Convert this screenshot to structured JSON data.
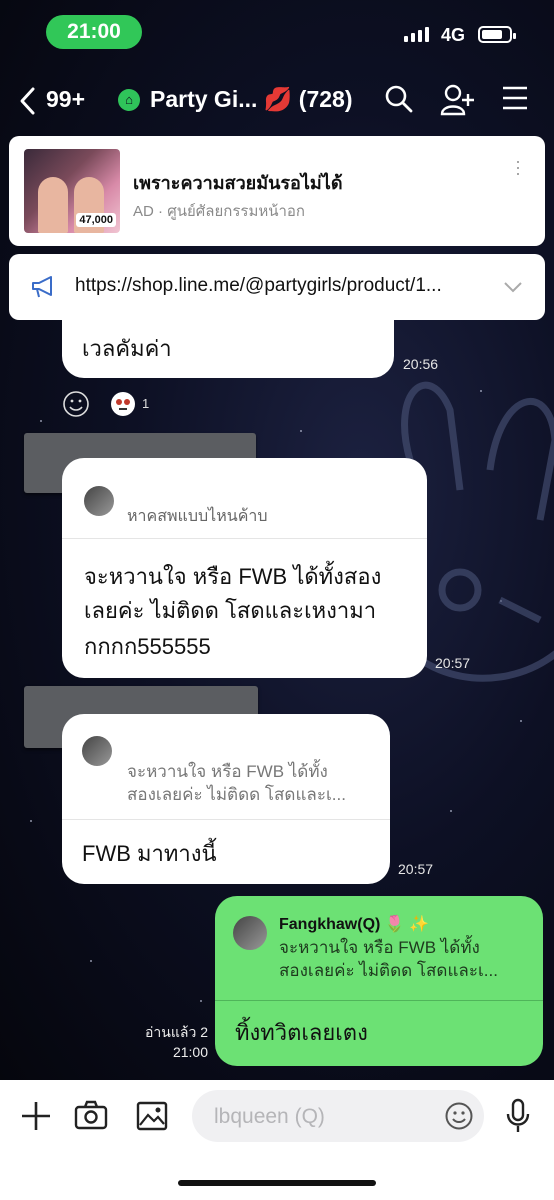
{
  "status_bar": {
    "time": "21:00",
    "network": "4G"
  },
  "header": {
    "unread_count": "99+",
    "group_name": "Party Gi... 💋",
    "member_count": "(728)"
  },
  "ad": {
    "title": "เพราะความสวยมันรอไม่ได้",
    "ad_label": "AD",
    "separator": "·",
    "advertiser": "ศูนย์ศัลยกรรมหน้าอก",
    "thumb_price": "47,000"
  },
  "announcement": {
    "url": "https://shop.line.me/@partygirls/product/1..."
  },
  "messages": [
    {
      "text": "เวลคัมค่า",
      "time": "20:56",
      "reaction_count": "1"
    },
    {
      "quote_text": "หาคสพแบบไหนค้าบ",
      "lines": [
        "จะหวานใจ หรือ FWB ได้ทั้งสอง",
        "เลยค่ะ ไม่ติดด  โสดและเหงามา",
        "กกกก555555"
      ],
      "time": "20:57"
    },
    {
      "quote_lines": [
        "จะหวานใจ หรือ FWB ได้ทั้ง",
        "สองเลยค่ะ ไม่ติดด โสดและเ..."
      ],
      "text": "FWB มาทางนี้",
      "time": "20:57"
    }
  ],
  "my_message": {
    "quote_name": "Fangkhaw(Q) 🌷 ✨",
    "quote_lines": [
      "จะหวานใจ หรือ FWB ได้ทั้ง",
      "สองเลยค่ะ ไม่ติดด โสดและเ..."
    ],
    "text": "ทิ้งทวิตเลยเตง",
    "read_status": "อ่านแล้ว 2",
    "time": "21:00"
  },
  "input": {
    "placeholder": "lbqueen (Q)"
  },
  "colors": {
    "line_green": "#6ce174",
    "status_green": "#31c758"
  }
}
